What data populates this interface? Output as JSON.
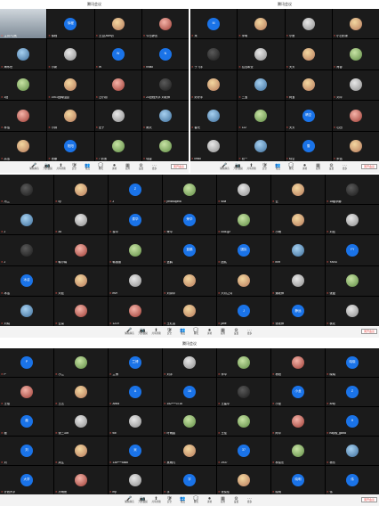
{
  "window_title": "腾讯会议",
  "toolbar": {
    "buttons": [
      {
        "label": "解除静音",
        "icon": "mic-off-icon",
        "glyph": "🎤",
        "alert": false
      },
      {
        "label": "开启视频",
        "icon": "camera-off-icon",
        "glyph": "📷",
        "alert": false
      },
      {
        "label": "共享屏幕",
        "icon": "share-screen-icon",
        "glyph": "⬆",
        "alert": false
      },
      {
        "label": "安全",
        "icon": "shield-icon",
        "glyph": "🛡",
        "alert": false
      },
      {
        "label": "成员",
        "icon": "members-icon",
        "glyph": "👥",
        "alert": false
      },
      {
        "label": "聊天",
        "icon": "chat-icon",
        "glyph": "💬",
        "alert": true
      },
      {
        "label": "录制",
        "icon": "record-icon",
        "glyph": "⏺",
        "alert": false
      },
      {
        "label": "应用",
        "icon": "apps-icon",
        "glyph": "▦",
        "alert": false
      },
      {
        "label": "设置",
        "icon": "gear-icon",
        "glyph": "⚙",
        "alert": false
      },
      {
        "label": "更多",
        "icon": "more-icon",
        "glyph": "⋯",
        "alert": false
      }
    ],
    "leave_label": "离开会议"
  },
  "panels": [
    {
      "id": "p1",
      "cols": 4,
      "tiles": [
        {
          "type": "video",
          "name": "主持人(我)"
        },
        {
          "type": "blue",
          "text": "徐程",
          "name": "徐程"
        },
        {
          "type": "photo",
          "v": "p1",
          "name": "王云(Avery)"
        },
        {
          "type": "photo",
          "v": "p5",
          "name": "今日静言"
        },
        {
          "type": "photo",
          "v": "p2",
          "name": "海水世"
        },
        {
          "type": "photo",
          "v": "p3",
          "name": "小新"
        },
        {
          "type": "blue",
          "text": "W",
          "name": "W"
        },
        {
          "type": "blue",
          "text": "N",
          "name": "nihao"
        },
        {
          "type": "photo",
          "v": "p4",
          "name": "1班"
        },
        {
          "type": "photo",
          "v": "p1",
          "name": "1901班韩佳园"
        },
        {
          "type": "photo",
          "v": "p5",
          "name": "汪小丽"
        },
        {
          "type": "photo",
          "v": "p6",
          "name": "23进程大学 刘老师"
        },
        {
          "type": "photo",
          "v": "p5",
          "name": "林浩"
        },
        {
          "type": "photo",
          "v": "p1",
          "name": "小胖"
        },
        {
          "type": "photo",
          "v": "p3",
          "name": "史子"
        },
        {
          "type": "photo",
          "v": "p2",
          "name": "雨天"
        },
        {
          "type": "photo",
          "v": "p1",
          "name": "高洁"
        },
        {
          "type": "blue",
          "text": "阳阳",
          "name": "张娜"
        },
        {
          "type": "photo",
          "v": "p4",
          "name": "7 抓紧"
        },
        {
          "type": "photo",
          "v": "p4",
          "name": "瑞雪"
        }
      ]
    },
    {
      "id": "p2",
      "cols": 4,
      "tiles": [
        {
          "type": "blue",
          "text": "M",
          "name": "米"
        },
        {
          "type": "photo",
          "v": "p1",
          "name": "李明"
        },
        {
          "type": "photo",
          "v": "p3",
          "name": "小鱼"
        },
        {
          "type": "photo",
          "v": "p1",
          "name": "小白的家"
        },
        {
          "type": "photo",
          "v": "p6",
          "name": "于飞宇"
        },
        {
          "type": "photo",
          "v": "p3",
          "name": "拉瓦希亚"
        },
        {
          "type": "photo",
          "v": "p1",
          "name": "天天"
        },
        {
          "type": "photo",
          "v": "p4",
          "name": "肖蓉"
        },
        {
          "type": "photo",
          "v": "p1",
          "name": "好好学"
        },
        {
          "type": "photo",
          "v": "p2",
          "name": "三宝"
        },
        {
          "type": "photo",
          "v": "p1",
          "name": "阿宝"
        },
        {
          "type": "photo",
          "v": "p3",
          "name": "刘华"
        },
        {
          "type": "photo",
          "v": "p2",
          "name": "春光"
        },
        {
          "type": "photo",
          "v": "p4",
          "name": "122"
        },
        {
          "type": "blue",
          "text": "晴空",
          "name": "天天"
        },
        {
          "type": "photo",
          "v": "p5",
          "name": "心田"
        },
        {
          "type": "photo",
          "v": "p3",
          "name": "linwu"
        },
        {
          "type": "photo",
          "v": "p2",
          "name": "初一"
        },
        {
          "type": "blue",
          "text": "雪",
          "name": "晴空"
        },
        {
          "type": "photo",
          "v": "p1",
          "name": "朱恬"
        }
      ]
    },
    {
      "id": "p3",
      "cols": 7,
      "tiles": [
        {
          "type": "photo",
          "v": "p6",
          "name": "冯兰"
        },
        {
          "type": "photo",
          "v": "p1",
          "name": "cy"
        },
        {
          "type": "blue",
          "text": "Z",
          "name": "Z"
        },
        {
          "type": "photo",
          "v": "p4",
          "name": "philosophia"
        },
        {
          "type": "photo",
          "v": "p3",
          "name": "sola"
        },
        {
          "type": "photo",
          "v": "p1",
          "name": "云"
        },
        {
          "type": "photo",
          "v": "p6",
          "name": "18级李娜"
        },
        {
          "type": "photo",
          "v": "p2",
          "name": "Z"
        },
        {
          "type": "photo",
          "v": "p3",
          "name": "zw"
        },
        {
          "type": "blue",
          "text": "泰华",
          "name": "泰华"
        },
        {
          "type": "blue",
          "text": "荣华",
          "name": "荣华"
        },
        {
          "type": "photo",
          "v": "p4",
          "name": "cool-gz"
        },
        {
          "type": "photo",
          "v": "p1",
          "name": "小雨"
        },
        {
          "type": "photo",
          "v": "p3",
          "name": "刘宏"
        },
        {
          "type": "photo",
          "v": "p6",
          "name": "Z"
        },
        {
          "type": "photo",
          "v": "p5",
          "name": "韩小娟"
        },
        {
          "type": "photo",
          "v": "p4",
          "name": "韩丽丽"
        },
        {
          "type": "blue",
          "text": "蓝鹤",
          "name": "蓝鹤"
        },
        {
          "type": "blue",
          "text": "团队",
          "name": "团队"
        },
        {
          "type": "photo",
          "v": "p2",
          "name": "b/lrt"
        },
        {
          "type": "blue",
          "text": "YY",
          "name": "YANG"
        },
        {
          "type": "blue",
          "text": "冰洁",
          "name": "冰洁"
        },
        {
          "type": "photo",
          "v": "p1",
          "name": "刘宏"
        },
        {
          "type": "photo",
          "v": "p3",
          "name": "mzr"
        },
        {
          "type": "photo",
          "v": "p1",
          "name": "刘诗华"
        },
        {
          "type": "photo",
          "v": "p1",
          "name": "六月之词"
        },
        {
          "type": "photo",
          "v": "p3",
          "name": "潘老师"
        },
        {
          "type": "photo",
          "v": "p4",
          "name": "张磊"
        },
        {
          "type": "photo",
          "v": "p2",
          "name": "刘晓"
        },
        {
          "type": "photo",
          "v": "p5",
          "name": "云朵"
        },
        {
          "type": "photo",
          "v": "p5",
          "name": "1219"
        },
        {
          "type": "photo",
          "v": "p1",
          "name": "王红霞"
        },
        {
          "type": "blue",
          "text": "J",
          "name": "jane"
        },
        {
          "type": "blue",
          "text": "静远",
          "name": "张老师"
        },
        {
          "type": "photo",
          "v": "p3",
          "name": "桃花"
        }
      ]
    },
    {
      "id": "p4",
      "cols": 7,
      "tiles": [
        {
          "type": "blue",
          "text": "P",
          "name": "P"
        },
        {
          "type": "photo",
          "v": "p4",
          "name": "小兰"
        },
        {
          "type": "blue",
          "text": "兰博",
          "name": "兰博"
        },
        {
          "type": "photo",
          "v": "p3",
          "name": "刘洋"
        },
        {
          "type": "photo",
          "v": "p4",
          "name": "李华"
        },
        {
          "type": "photo",
          "v": "p5",
          "name": "杨阳"
        },
        {
          "type": "blue",
          "text": "晓晓",
          "name": "晓晓"
        },
        {
          "type": "photo",
          "v": "p5",
          "name": "王怡"
        },
        {
          "type": "photo",
          "v": "p1",
          "name": "王五"
        },
        {
          "type": "blue",
          "text": "A",
          "name": "Anna"
        },
        {
          "type": "blue",
          "text": "16",
          "name": "152****3716"
        },
        {
          "type": "photo",
          "v": "p6",
          "name": "王建华"
        },
        {
          "type": "blue",
          "text": "小龙",
          "name": "小龙"
        },
        {
          "type": "blue",
          "text": "Z",
          "name": "zzzy"
        },
        {
          "type": "blue",
          "text": "薇",
          "name": "薇"
        },
        {
          "type": "photo",
          "v": "p3",
          "name": "张三339"
        },
        {
          "type": "photo",
          "v": "p3",
          "name": "wb"
        },
        {
          "type": "photo",
          "v": "p4",
          "name": "叶雨晨"
        },
        {
          "type": "photo",
          "v": "p4",
          "name": "王佳"
        },
        {
          "type": "photo",
          "v": "p5",
          "name": "阿华"
        },
        {
          "type": "blue",
          "text": "H",
          "name": "happy_global"
        },
        {
          "type": "blue",
          "text": "刘",
          "name": "刘"
        },
        {
          "type": "photo",
          "v": "p1",
          "name": "周生"
        },
        {
          "type": "blue",
          "text": "米",
          "name": "138****4888"
        },
        {
          "type": "photo",
          "v": "p1",
          "name": "吴雨凡"
        },
        {
          "type": "blue",
          "text": "37",
          "name": "2937"
        },
        {
          "type": "photo",
          "v": "p4",
          "name": "林俊杰"
        },
        {
          "type": "photo",
          "v": "p2",
          "name": "杨东"
        },
        {
          "type": "blue",
          "text": "大学",
          "name": "计划大学"
        },
        {
          "type": "photo",
          "v": "p5",
          "name": "冷雨夜"
        },
        {
          "type": "photo",
          "v": "p3",
          "name": "mp"
        },
        {
          "type": "blue",
          "text": "宇",
          "name": "宇"
        },
        {
          "type": "photo",
          "v": "p1",
          "name": "张俊佳"
        },
        {
          "type": "blue",
          "text": "晓明",
          "name": "晓明"
        },
        {
          "type": "blue",
          "text": "伟",
          "name": "伟"
        }
      ]
    }
  ]
}
